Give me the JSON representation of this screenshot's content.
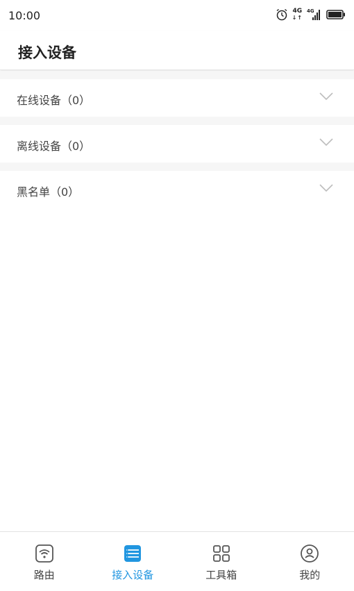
{
  "status_bar": {
    "time": "10:00",
    "network_top": "4G",
    "network_sub": "4G",
    "icons": [
      "alarm-icon",
      "network-4g-icon",
      "signal-icon",
      "battery-icon"
    ]
  },
  "header": {
    "title": "接入设备"
  },
  "sections": [
    {
      "label": "在线设备（0）"
    },
    {
      "label": "离线设备（0）"
    },
    {
      "label": "黑名单（0）"
    }
  ],
  "bottom_nav": [
    {
      "label": "路由",
      "icon": "router-wifi-icon",
      "active": false
    },
    {
      "label": "接入设备",
      "icon": "device-list-icon",
      "active": true
    },
    {
      "label": "工具箱",
      "icon": "toolbox-grid-icon",
      "active": false
    },
    {
      "label": "我的",
      "icon": "user-profile-icon",
      "active": false
    }
  ],
  "colors": {
    "accent": "#2196e0",
    "text": "#444444",
    "section_gap": "#f6f6f6"
  }
}
